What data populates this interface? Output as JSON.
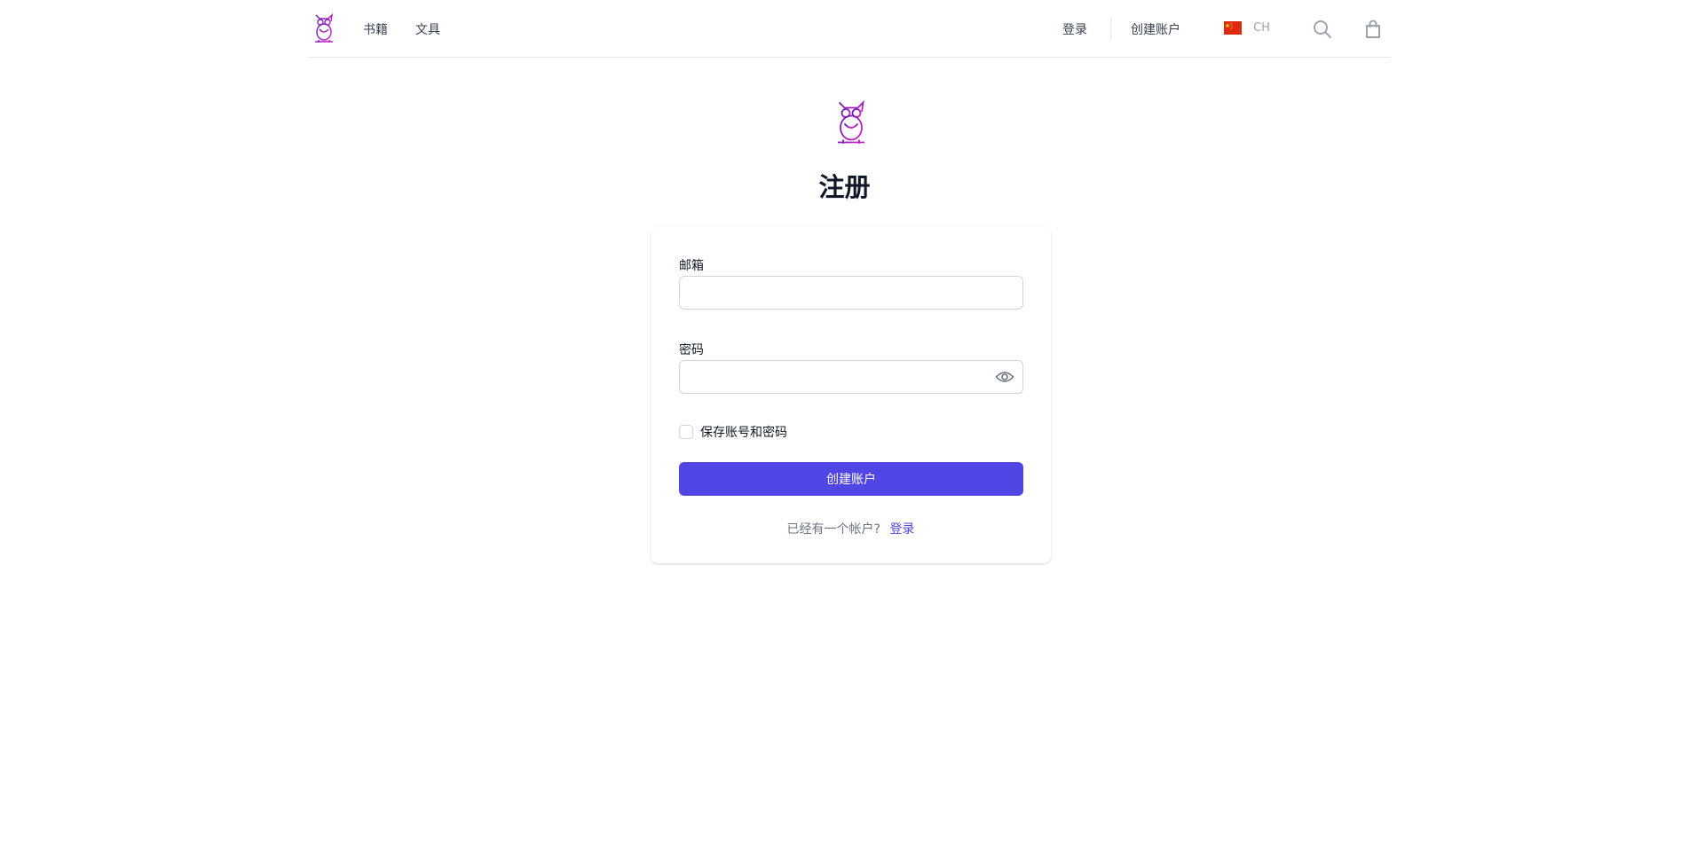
{
  "header": {
    "logo": "owl-logo",
    "nav": [
      {
        "label": "书籍"
      },
      {
        "label": "文具"
      }
    ],
    "signin_label": "登录",
    "create_account_label": "创建账户",
    "locale": {
      "flag": "china-flag",
      "code": "CH"
    },
    "icons": [
      "search-icon",
      "shopping-bag-icon"
    ]
  },
  "main": {
    "title": "注册",
    "form": {
      "email_label": "邮箱",
      "email_value": "",
      "password_label": "密码",
      "password_value": "",
      "remember_label": "保存账号和密码",
      "remember_checked": false,
      "submit_label": "创建账户",
      "footer_text": "已经有一个帐户?",
      "footer_link": "登录"
    }
  },
  "colors": {
    "accent": "#4f46e5",
    "logo_gradient_start": "#7c1fd1",
    "logo_gradient_end": "#e01cc9",
    "border": "#d1d5db"
  }
}
